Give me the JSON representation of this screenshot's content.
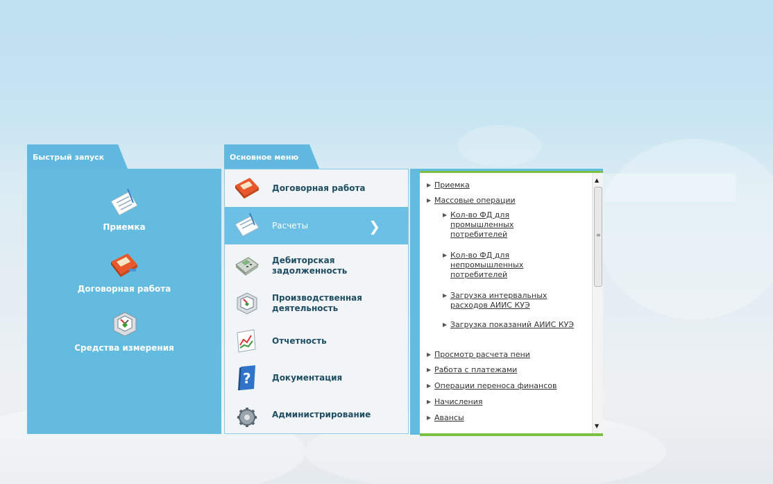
{
  "quick_launch": {
    "tab_label": "Быстрый запуск",
    "items": [
      {
        "label": "Приемка",
        "icon": "signed-document-icon"
      },
      {
        "label": "Договорная работа",
        "icon": "contract-folder-icon"
      },
      {
        "label": "Средства измерения",
        "icon": "meter-gauge-icon"
      }
    ]
  },
  "main_menu": {
    "tab_label": "Основное меню",
    "active_index": 1,
    "items": [
      {
        "label": "Договорная работа",
        "icon": "contract-folder-icon"
      },
      {
        "label": "Расчеты",
        "icon": "signed-document-icon"
      },
      {
        "label": "Дебиторская задолженность",
        "icon": "calculator-icon"
      },
      {
        "label": "Производственная деятельность",
        "icon": "meter-gauge-icon"
      },
      {
        "label": "Отчетность",
        "icon": "chart-report-icon"
      },
      {
        "label": "Документация",
        "icon": "help-book-icon"
      },
      {
        "label": "Администрирование",
        "icon": "gear-icon"
      }
    ]
  },
  "submenu": {
    "items": [
      {
        "label": "Приемка",
        "level": 0
      },
      {
        "label": "Массовые операции",
        "level": 0
      },
      {
        "label": "Кол-во ФД для промышленных потребителей",
        "level": 1
      },
      {
        "label": "Кол-во ФД для непромышленных потребителей",
        "level": 1
      },
      {
        "label": "Загрузка интервальных расходов АИИС КУЭ",
        "level": 1
      },
      {
        "label": "Загрузка показаний АИИС КУЭ",
        "level": 1
      },
      {
        "label": "Просмотр расчета пени",
        "level": 0
      },
      {
        "label": "Работа с платежами",
        "level": 0
      },
      {
        "label": "Операции переноса финансов",
        "level": 0
      },
      {
        "label": "Начисления",
        "level": 0
      },
      {
        "label": "Авансы",
        "level": 0
      }
    ]
  },
  "colors": {
    "panel_blue": "#64bbe0",
    "active_blue": "#6cc0e5",
    "accent_green": "#7ac142",
    "menu_text": "#1f4d63"
  }
}
